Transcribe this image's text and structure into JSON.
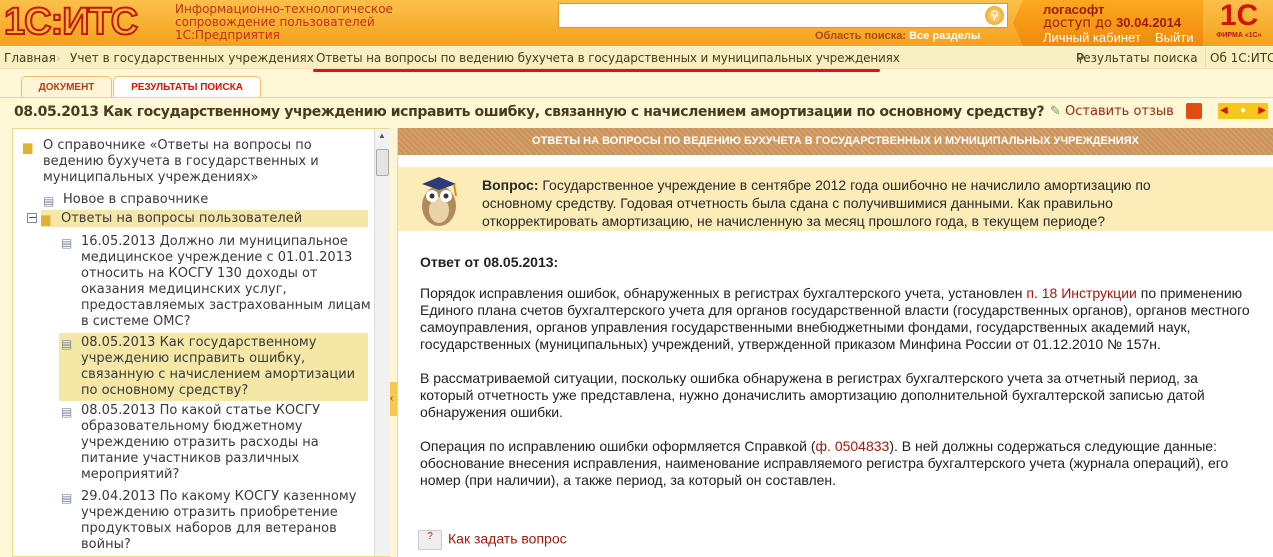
{
  "header": {
    "logo": "1С:ИТС",
    "subtitle": [
      "Информационно-технологическое",
      "сопровождение пользователей",
      "1С:Предприятия"
    ],
    "search_value": "",
    "scope_label": "Область поиска:",
    "scope_value": "Все разделы",
    "account_name": "логасофт",
    "access_label": "доступ до",
    "access_date": "30.04.2014",
    "cabinet": "Личный кабинет",
    "logout": "Выйти",
    "firm_logo": "1С",
    "firm_label": "ФИРМА «1С»"
  },
  "breadcrumb": {
    "items": [
      "Главная",
      "Учет в государственных учреждениях",
      "Ответы на вопросы по ведению бухучета в государственных и муниципальных учреждениях"
    ],
    "search_results": "Результаты поиска",
    "about": "Об 1С:ИТС"
  },
  "tabs": [
    "ДОКУМЕНТ",
    "РЕЗУЛЬТАТЫ ПОИСКА"
  ],
  "title": "08.05.2013 Как государственному учреждению исправить ошибку, связанную с начислением амортизации по основному средству?",
  "toolbar": {
    "feedback": "Оставить отзыв"
  },
  "tree": [
    "О справочнике «Ответы на вопросы по ведению бухучета в государственных и муниципальных учреждениях»",
    "Новое в справочнике",
    "Ответы на вопросы пользователей",
    "16.05.2013 Должно ли муниципальное медицинское учреждение с 01.01.2013 относить на КОСГУ 130 доходы от оказания медицинских услуг, предоставляемых застрахованным лицам в системе ОМС?",
    "08.05.2013 Как государственному учреждению исправить ошибку, связанную с начислением амортизации по основному средству?",
    "08.05.2013 По какой статье КОСГУ образовательному бюджетному учреждению отразить расходы на питание участников различных мероприятий?",
    "29.04.2013 По какому КОСГУ казенному учреждению отразить приобретение продуктовых наборов для ветеранов войны?"
  ],
  "main": {
    "header": "ОТВЕТЫ НА ВОПРОСЫ ПО ВЕДЕНИЮ БУХУЧЕТА В ГОСУДАРСТВЕННЫХ И МУНИЦИПАЛЬНЫХ УЧРЕЖДЕНИЯХ",
    "question_label": "Вопрос:",
    "question": "Государственное учреждение в сентябре 2012 года ошибочно не начислило амортизацию по основному средству. Годовая отчетность была сдана с получившимися данными. Как правильно откорректировать амортизацию, не начисленную за месяц прошлого года, в текущем периоде?",
    "answer_title": "Ответ от 08.05.2013:",
    "p1a": "Порядок исправления ошибок, обнаруженных в регистрах бухгалтерского учета, установлен ",
    "p1_link": "п. 18 Инструкции",
    "p1b": " по применению Единого плана счетов бухгалтерского учета для органов государственной власти (государственных органов), органов местного самоуправления, органов управления государственными внебюджетными фондами, государственных академий наук, государственных (муниципальных) учреждений, утвержденной приказом Минфина России от 01.12.2010 № 157н.",
    "p2": "В рассматриваемой ситуации, поскольку ошибка обнаружена в регистрах бухгалтерского учета за отчетный период, за который отчетность уже представлена, нужно доначислить амортизацию дополнительной бухгалтерской записью датой обнаружения ошибки.",
    "p3a": "Операция по исправлению ошибки оформляется Справкой (",
    "p3_link": "ф. 0504833",
    "p3b": "). В ней должны содержаться следующие данные: обоснование внесения исправления, наименование исправляемого регистра бухгалтерского учета (журнала операций), его номер (при наличии), а также период, за который он составлен.",
    "ask": "Как задать вопрос"
  }
}
